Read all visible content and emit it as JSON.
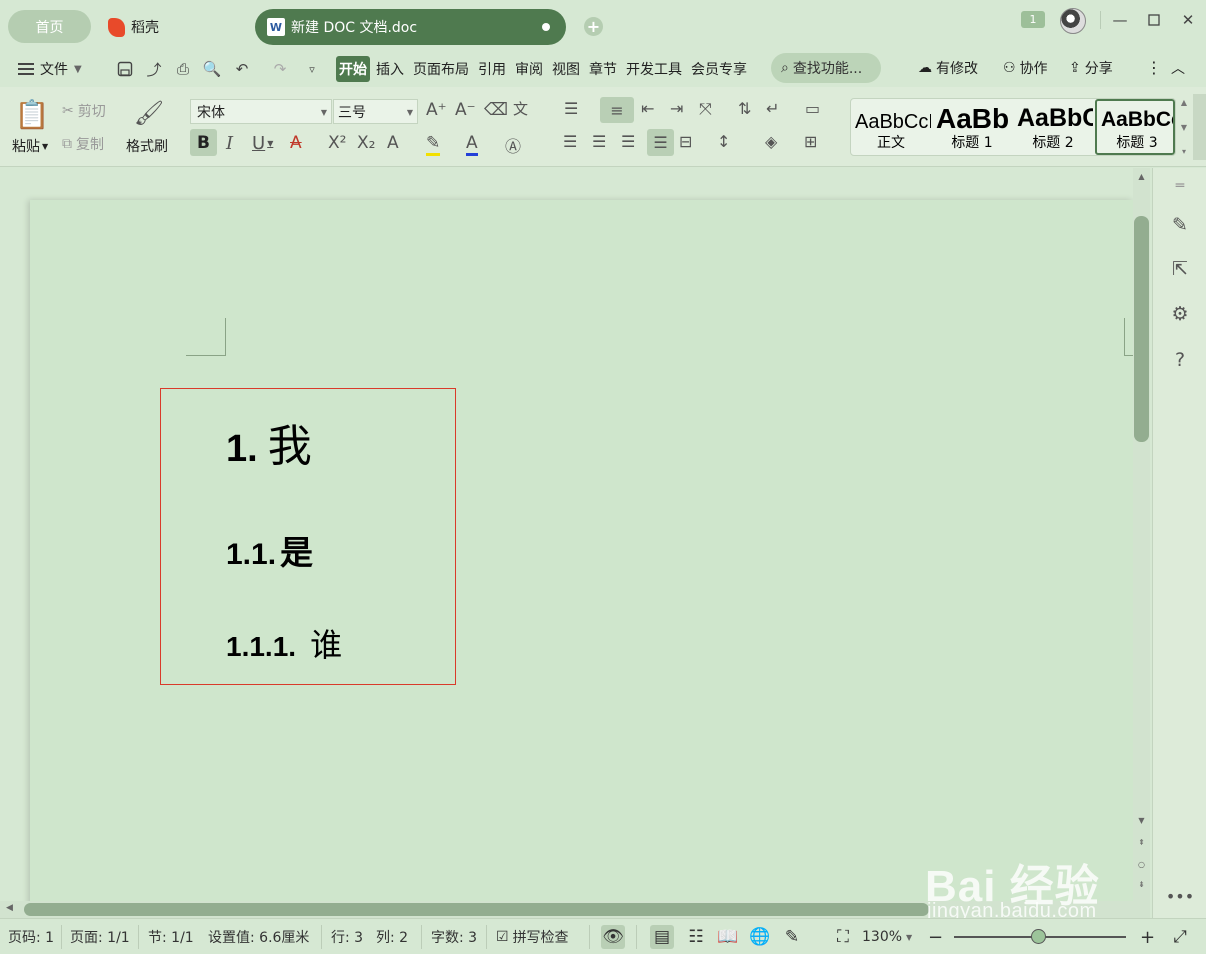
{
  "titlebar": {
    "home_tab": "首页",
    "daoke_tab": "稻壳",
    "doc_tab": "新建 DOC 文档.doc",
    "badge_count": "1"
  },
  "menubar": {
    "file": "文件",
    "tabs": [
      "开始",
      "插入",
      "页面布局",
      "引用",
      "审阅",
      "视图",
      "章节",
      "开发工具",
      "会员专享"
    ],
    "search_placeholder": "查找功能...",
    "modified": "有修改",
    "collaborate": "协作",
    "share": "分享"
  },
  "ribbon": {
    "paste": "粘贴",
    "cut": "剪切",
    "copy": "复制",
    "format_painter": "格式刷",
    "font_name": "宋体",
    "font_size": "三号",
    "styles": [
      {
        "sample": "AaBbCcDd",
        "name": "正文"
      },
      {
        "sample": "AaBb",
        "name": "标题 1"
      },
      {
        "sample": "AaBbC",
        "name": "标题 2"
      },
      {
        "sample": "AaBbCcD",
        "name": "标题 3"
      }
    ]
  },
  "document": {
    "headings": [
      {
        "number": "1.",
        "text": "我"
      },
      {
        "number": "1.1.",
        "text": "是"
      },
      {
        "number": "1.1.1.",
        "text": "谁"
      }
    ]
  },
  "status": {
    "page_num": "页码: 1",
    "pages": "页面: 1/1",
    "section": "节: 1/1",
    "setting": "设置值: 6.6厘米",
    "row": "行: 3",
    "col": "列: 2",
    "word_count": "字数: 3",
    "spell_check": "拼写检查",
    "zoom": "130%",
    "zoom_fraction": 0.49
  },
  "watermark": {
    "main": "Bai 经验",
    "sub": "jingyan.baidu.com"
  },
  "colors": {
    "accent": "#4f7a4f",
    "background": "#d6e8d3",
    "page": "#cfe6cc",
    "highlight_border": "#d93a2a"
  }
}
